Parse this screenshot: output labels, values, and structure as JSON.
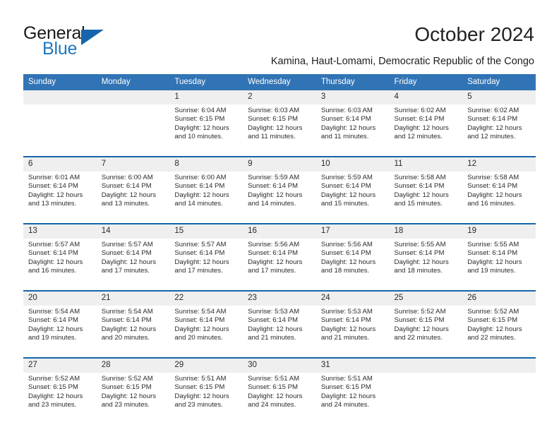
{
  "brand": {
    "name_top": "General",
    "name_bottom": "Blue",
    "triangle_icon": "triangle-logo-icon",
    "color_top": "#1a1a1a",
    "color_bottom": "#1f77bd",
    "triangle_color": "#1664ac"
  },
  "header": {
    "title": "October 2024",
    "subtitle": "Kamina, Haut-Lomami, Democratic Republic of the Congo"
  },
  "theme": {
    "header_blue": "#3174b5",
    "rule_blue": "#1664ac",
    "daynum_band": "#efefef",
    "cell_bg": "#ffffff",
    "text": "#2b2b2b"
  },
  "calendar": {
    "weekday_headers": [
      "Sunday",
      "Monday",
      "Tuesday",
      "Wednesday",
      "Thursday",
      "Friday",
      "Saturday"
    ],
    "weeks": [
      {
        "days": [
          {
            "date": "",
            "lines": []
          },
          {
            "date": "",
            "lines": []
          },
          {
            "date": "1",
            "lines": [
              "Sunrise: 6:04 AM",
              "Sunset: 6:15 PM",
              "Daylight: 12 hours",
              "and 10 minutes."
            ]
          },
          {
            "date": "2",
            "lines": [
              "Sunrise: 6:03 AM",
              "Sunset: 6:15 PM",
              "Daylight: 12 hours",
              "and 11 minutes."
            ]
          },
          {
            "date": "3",
            "lines": [
              "Sunrise: 6:03 AM",
              "Sunset: 6:14 PM",
              "Daylight: 12 hours",
              "and 11 minutes."
            ]
          },
          {
            "date": "4",
            "lines": [
              "Sunrise: 6:02 AM",
              "Sunset: 6:14 PM",
              "Daylight: 12 hours",
              "and 12 minutes."
            ]
          },
          {
            "date": "5",
            "lines": [
              "Sunrise: 6:02 AM",
              "Sunset: 6:14 PM",
              "Daylight: 12 hours",
              "and 12 minutes."
            ]
          }
        ]
      },
      {
        "days": [
          {
            "date": "6",
            "lines": [
              "Sunrise: 6:01 AM",
              "Sunset: 6:14 PM",
              "Daylight: 12 hours",
              "and 13 minutes."
            ]
          },
          {
            "date": "7",
            "lines": [
              "Sunrise: 6:00 AM",
              "Sunset: 6:14 PM",
              "Daylight: 12 hours",
              "and 13 minutes."
            ]
          },
          {
            "date": "8",
            "lines": [
              "Sunrise: 6:00 AM",
              "Sunset: 6:14 PM",
              "Daylight: 12 hours",
              "and 14 minutes."
            ]
          },
          {
            "date": "9",
            "lines": [
              "Sunrise: 5:59 AM",
              "Sunset: 6:14 PM",
              "Daylight: 12 hours",
              "and 14 minutes."
            ]
          },
          {
            "date": "10",
            "lines": [
              "Sunrise: 5:59 AM",
              "Sunset: 6:14 PM",
              "Daylight: 12 hours",
              "and 15 minutes."
            ]
          },
          {
            "date": "11",
            "lines": [
              "Sunrise: 5:58 AM",
              "Sunset: 6:14 PM",
              "Daylight: 12 hours",
              "and 15 minutes."
            ]
          },
          {
            "date": "12",
            "lines": [
              "Sunrise: 5:58 AM",
              "Sunset: 6:14 PM",
              "Daylight: 12 hours",
              "and 16 minutes."
            ]
          }
        ]
      },
      {
        "days": [
          {
            "date": "13",
            "lines": [
              "Sunrise: 5:57 AM",
              "Sunset: 6:14 PM",
              "Daylight: 12 hours",
              "and 16 minutes."
            ]
          },
          {
            "date": "14",
            "lines": [
              "Sunrise: 5:57 AM",
              "Sunset: 6:14 PM",
              "Daylight: 12 hours",
              "and 17 minutes."
            ]
          },
          {
            "date": "15",
            "lines": [
              "Sunrise: 5:57 AM",
              "Sunset: 6:14 PM",
              "Daylight: 12 hours",
              "and 17 minutes."
            ]
          },
          {
            "date": "16",
            "lines": [
              "Sunrise: 5:56 AM",
              "Sunset: 6:14 PM",
              "Daylight: 12 hours",
              "and 17 minutes."
            ]
          },
          {
            "date": "17",
            "lines": [
              "Sunrise: 5:56 AM",
              "Sunset: 6:14 PM",
              "Daylight: 12 hours",
              "and 18 minutes."
            ]
          },
          {
            "date": "18",
            "lines": [
              "Sunrise: 5:55 AM",
              "Sunset: 6:14 PM",
              "Daylight: 12 hours",
              "and 18 minutes."
            ]
          },
          {
            "date": "19",
            "lines": [
              "Sunrise: 5:55 AM",
              "Sunset: 6:14 PM",
              "Daylight: 12 hours",
              "and 19 minutes."
            ]
          }
        ]
      },
      {
        "days": [
          {
            "date": "20",
            "lines": [
              "Sunrise: 5:54 AM",
              "Sunset: 6:14 PM",
              "Daylight: 12 hours",
              "and 19 minutes."
            ]
          },
          {
            "date": "21",
            "lines": [
              "Sunrise: 5:54 AM",
              "Sunset: 6:14 PM",
              "Daylight: 12 hours",
              "and 20 minutes."
            ]
          },
          {
            "date": "22",
            "lines": [
              "Sunrise: 5:54 AM",
              "Sunset: 6:14 PM",
              "Daylight: 12 hours",
              "and 20 minutes."
            ]
          },
          {
            "date": "23",
            "lines": [
              "Sunrise: 5:53 AM",
              "Sunset: 6:14 PM",
              "Daylight: 12 hours",
              "and 21 minutes."
            ]
          },
          {
            "date": "24",
            "lines": [
              "Sunrise: 5:53 AM",
              "Sunset: 6:14 PM",
              "Daylight: 12 hours",
              "and 21 minutes."
            ]
          },
          {
            "date": "25",
            "lines": [
              "Sunrise: 5:52 AM",
              "Sunset: 6:15 PM",
              "Daylight: 12 hours",
              "and 22 minutes."
            ]
          },
          {
            "date": "26",
            "lines": [
              "Sunrise: 5:52 AM",
              "Sunset: 6:15 PM",
              "Daylight: 12 hours",
              "and 22 minutes."
            ]
          }
        ]
      },
      {
        "days": [
          {
            "date": "27",
            "lines": [
              "Sunrise: 5:52 AM",
              "Sunset: 6:15 PM",
              "Daylight: 12 hours",
              "and 23 minutes."
            ]
          },
          {
            "date": "28",
            "lines": [
              "Sunrise: 5:52 AM",
              "Sunset: 6:15 PM",
              "Daylight: 12 hours",
              "and 23 minutes."
            ]
          },
          {
            "date": "29",
            "lines": [
              "Sunrise: 5:51 AM",
              "Sunset: 6:15 PM",
              "Daylight: 12 hours",
              "and 23 minutes."
            ]
          },
          {
            "date": "30",
            "lines": [
              "Sunrise: 5:51 AM",
              "Sunset: 6:15 PM",
              "Daylight: 12 hours",
              "and 24 minutes."
            ]
          },
          {
            "date": "31",
            "lines": [
              "Sunrise: 5:51 AM",
              "Sunset: 6:15 PM",
              "Daylight: 12 hours",
              "and 24 minutes."
            ]
          },
          {
            "date": "",
            "lines": []
          },
          {
            "date": "",
            "lines": []
          }
        ]
      }
    ]
  }
}
